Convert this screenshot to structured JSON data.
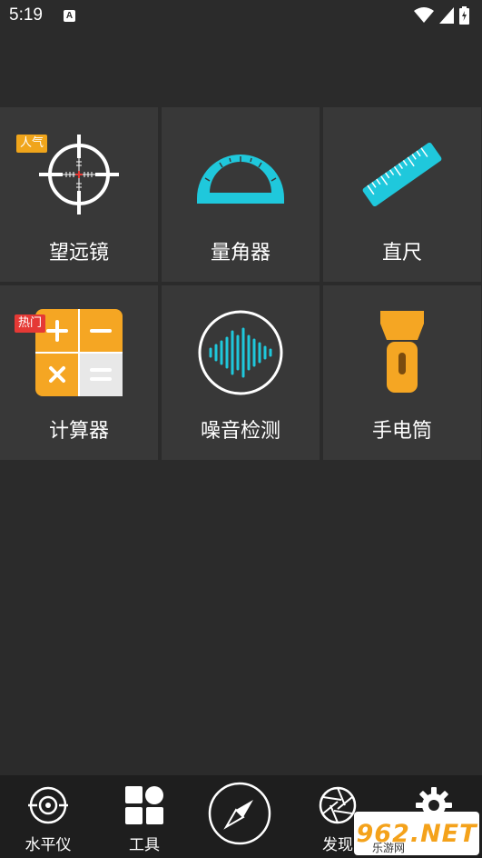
{
  "status_bar": {
    "time": "5:19",
    "notification_icon": "A"
  },
  "tools": [
    {
      "label": "望远镜",
      "badge": "人气",
      "icon": "telescope-crosshair-icon"
    },
    {
      "label": "量角器",
      "icon": "protractor-icon"
    },
    {
      "label": "直尺",
      "icon": "ruler-icon"
    },
    {
      "label": "计算器",
      "badge": "热门",
      "icon": "calculator-icon"
    },
    {
      "label": "噪音检测",
      "icon": "sound-wave-icon"
    },
    {
      "label": "手电筒",
      "icon": "flashlight-icon"
    }
  ],
  "bottom_nav": {
    "items": [
      {
        "label": "水平仪",
        "icon": "level-target-icon"
      },
      {
        "label": "工具",
        "icon": "grid-tools-icon"
      },
      {
        "label": "",
        "icon": "compass-icon"
      },
      {
        "label": "发现",
        "icon": "aperture-icon"
      },
      {
        "label": "",
        "icon": "gear-icon"
      }
    ]
  },
  "watermark": {
    "main": "962.NET",
    "sub": "乐游网"
  },
  "colors": {
    "background": "#2b2b2b",
    "tile": "#383838",
    "accent_cyan": "#1fc8dc",
    "accent_orange": "#f5a623",
    "badge_red": "#e53935",
    "nav_bg": "#1e1e1e"
  }
}
